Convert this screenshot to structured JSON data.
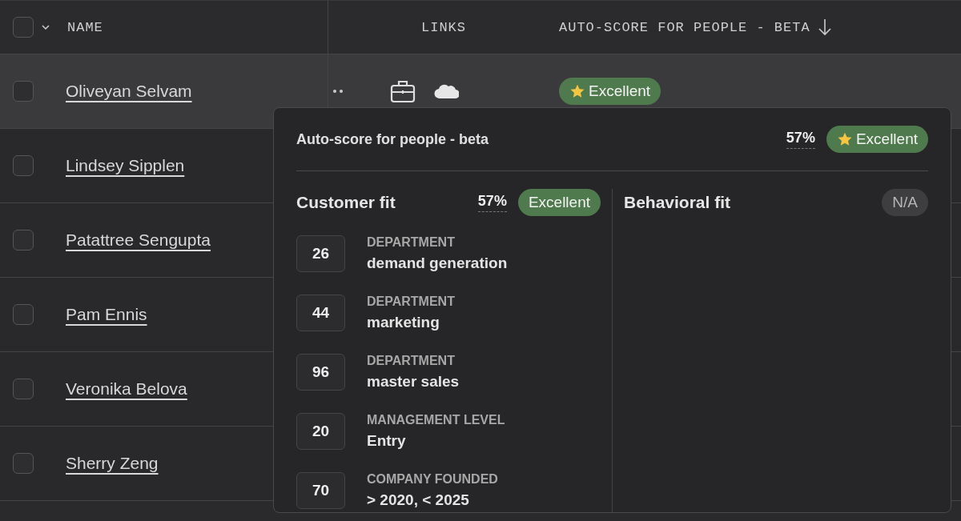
{
  "table": {
    "select_all": {
      "checked": false
    },
    "columns": [
      {
        "label": "NAME",
        "sorted": false
      },
      {
        "label": "LINKS",
        "sorted": false
      },
      {
        "label": "AUTO-SCORE FOR PEOPLE - BETA",
        "sorted": true
      }
    ],
    "rows": [
      {
        "name": "Oliveyan Selvam",
        "checked": false,
        "highlighted": true,
        "links": true,
        "score": {
          "text": "Excellent",
          "kind": "excellent",
          "star": true
        }
      },
      {
        "name": "Lindsey Sipplen",
        "checked": false,
        "highlighted": false
      },
      {
        "name": "Patattree Sengupta",
        "checked": false,
        "highlighted": false
      },
      {
        "name": "Pam Ennis",
        "checked": false,
        "highlighted": false
      },
      {
        "name": "Veronika Belova",
        "checked": false,
        "highlighted": false
      },
      {
        "name": "Sherry Zeng",
        "checked": false,
        "highlighted": false
      }
    ]
  },
  "popover": {
    "title": "Auto-score for people - beta",
    "percent": "57%",
    "badge": {
      "text": "Excellent",
      "kind": "excellent",
      "star": true
    },
    "sections": [
      {
        "title": "Customer fit",
        "percent": "57%",
        "badge": {
          "text": "Excellent",
          "kind": "excellent",
          "star": false
        },
        "factors": [
          {
            "score": "26",
            "label": "DEPARTMENT",
            "value": "demand generation"
          },
          {
            "score": "44",
            "label": "DEPARTMENT",
            "value": "marketing"
          },
          {
            "score": "96",
            "label": "DEPARTMENT",
            "value": "master sales"
          },
          {
            "score": "20",
            "label": "MANAGEMENT LEVEL",
            "value": "Entry"
          },
          {
            "score": "70",
            "label": "COMPANY FOUNDED",
            "value": "> 2020, < 2025"
          }
        ]
      },
      {
        "title": "Behavioral fit",
        "badge": {
          "text": "N/A",
          "kind": "na",
          "star": false
        }
      }
    ]
  }
}
